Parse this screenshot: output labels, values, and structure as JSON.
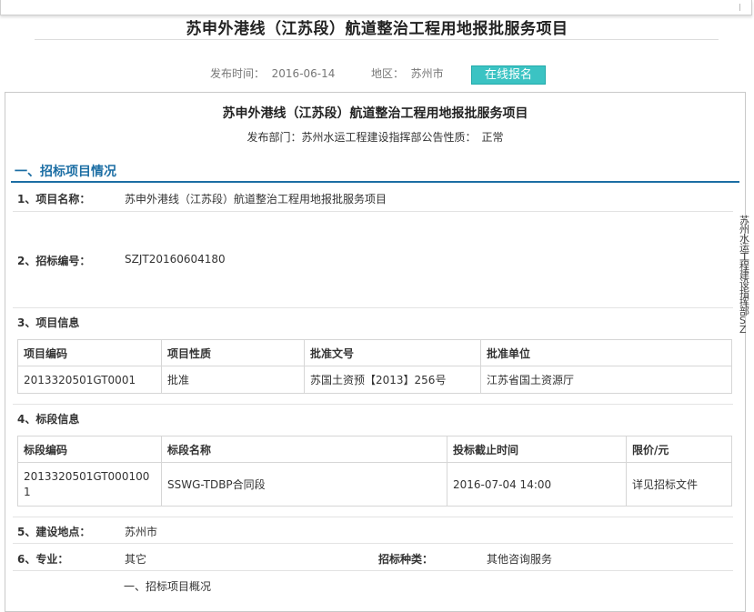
{
  "header": {
    "title": "苏申外港线（江苏段）航道整治工程用地报批服务项目",
    "publish_label": "发布时间：",
    "publish_date": "2016-06-14",
    "region_label": "地区：",
    "region": "苏州市",
    "apply_button": "在线报名"
  },
  "content": {
    "title": "苏申外港线（江苏段）航道整治工程用地报批服务项目",
    "dept_line": "发布部门：苏州水运工程建设指挥部公告性质：　正常",
    "section1": "一、招标项目情况",
    "project_name_label": "1、项目名称：",
    "project_name": "苏申外港线（江苏段）航道整治工程用地报批服务项目",
    "tender_no_label": "2、招标编号：",
    "tender_no": "SZJT20160604180",
    "project_info_label": "3、项目信息",
    "project_table": {
      "headers": [
        "项目编码",
        "项目性质",
        "批准文号",
        "批准单位"
      ],
      "row": [
        "2013320501GT0001",
        "批准",
        "苏国土资预【2013】256号",
        "江苏省国土资源厅"
      ]
    },
    "section_info_label": "4、标段信息",
    "section_table": {
      "headers": [
        "标段编码",
        "标段名称",
        "投标截止时间",
        "限价/元"
      ],
      "row": [
        "2013320501GT0001001",
        "SSWG-TDBP合同段",
        "2016-07-04 14:00",
        "详见招标文件"
      ]
    },
    "location_label": "5、建设地点：",
    "location": "苏州市",
    "specialty_label": "6、专业：",
    "specialty": "其它",
    "tender_type_label": "招标种类：",
    "tender_type": "其他咨询服务",
    "overview": "一、招标项目概况"
  },
  "side_text": "苏州水运工程建设指挥部SZ"
}
